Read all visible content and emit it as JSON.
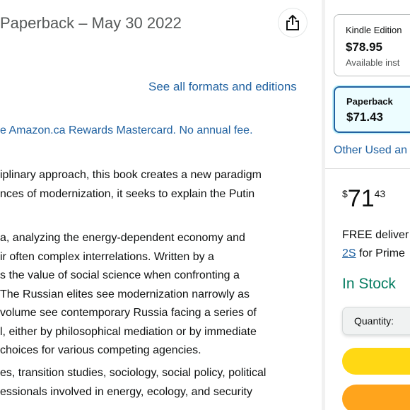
{
  "product": {
    "title_fragment": " Paperback – May 30 2022"
  },
  "links": {
    "see_all_formats": "See all formats and editions"
  },
  "promo": {
    "text": "e Amazon.ca Rewards Mastercard. No annual fee."
  },
  "description": {
    "paragraph1": [
      "iplinary approach, this book creates a new paradigm",
      "nces of modernization, it seeks to explain the Putin"
    ],
    "paragraph2": [
      "a, analyzing the energy-dependent economy and",
      "ir often complex interrelations. Written by a",
      "s the value of social science when confronting a",
      "The Russian elites see modernization narrowly as",
      "volume see contemporary Russia facing a series of",
      "l, either by philosophical mediation or by immediate",
      "choices for various competing agencies."
    ],
    "paragraph3": [
      "es, transition studies, sociology, social policy, political",
      "essionals involved in energy, ecology, and security"
    ]
  },
  "formats": {
    "kindle": {
      "label": "Kindle Edition",
      "price": "$78.95",
      "sub": "Available inst"
    },
    "paperback": {
      "label": "Paperback",
      "price": "$71.43"
    }
  },
  "buybox": {
    "other_used": "Other Used an",
    "price_symbol": "$",
    "price_whole": "71",
    "price_fraction": "43",
    "delivery_line1": "FREE deliver",
    "delivery_link": "2S",
    "delivery_line2_rest": " for Prime",
    "stock": "In Stock",
    "quantity_label": "Quantity:"
  },
  "colors": {
    "link": "#2162a1",
    "in_stock": "#067d62",
    "add_to_cart": "#ffd814",
    "buy_now": "#ffa41c"
  }
}
